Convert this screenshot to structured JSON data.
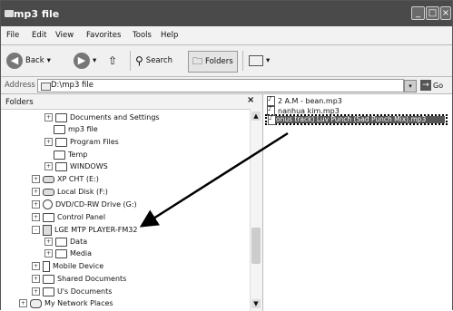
{
  "window": {
    "title": "mp3 file",
    "buttons": {
      "minimize": "_",
      "maximize": "□",
      "close": "×"
    }
  },
  "menu": [
    "File",
    "Edit",
    "View",
    "Favorites",
    "Tools",
    "Help"
  ],
  "toolbar": {
    "back": "Back",
    "search": "Search",
    "folders": "Folders"
  },
  "address": {
    "label": "Address",
    "value": "D:\\mp3 file",
    "go": "Go"
  },
  "folders_pane": {
    "header": "Folders",
    "items": [
      {
        "label": "Documents and Settings",
        "expander": "+"
      },
      {
        "label": "mp3 file",
        "expander": ""
      },
      {
        "label": "Program Files",
        "expander": "+"
      },
      {
        "label": "Temp",
        "expander": ""
      },
      {
        "label": "WINDOWS",
        "expander": "+"
      },
      {
        "label": "XP CHT (E:)",
        "expander": "+"
      },
      {
        "label": "Local Disk (F:)",
        "expander": "+"
      },
      {
        "label": "DVD/CD-RW Drive (G:)",
        "expander": "+"
      },
      {
        "label": "Control Panel",
        "expander": "+"
      },
      {
        "label": "LGE MTP PLAYER-FM32",
        "expander": "-"
      },
      {
        "label": "Data",
        "expander": "+"
      },
      {
        "label": "Media",
        "expander": "+"
      },
      {
        "label": "Mobile Device",
        "expander": "+"
      },
      {
        "label": "Shared Documents",
        "expander": "+"
      },
      {
        "label": "U's Documents",
        "expander": "+"
      },
      {
        "label": "My Network Places",
        "expander": "+"
      }
    ]
  },
  "files": [
    {
      "name": "2 A.M - bean.mp3"
    },
    {
      "name": "nanhua kim.mp3"
    },
    {
      "name": "onus track) Luv Punch (Sad Punch Mix).mp3"
    }
  ]
}
